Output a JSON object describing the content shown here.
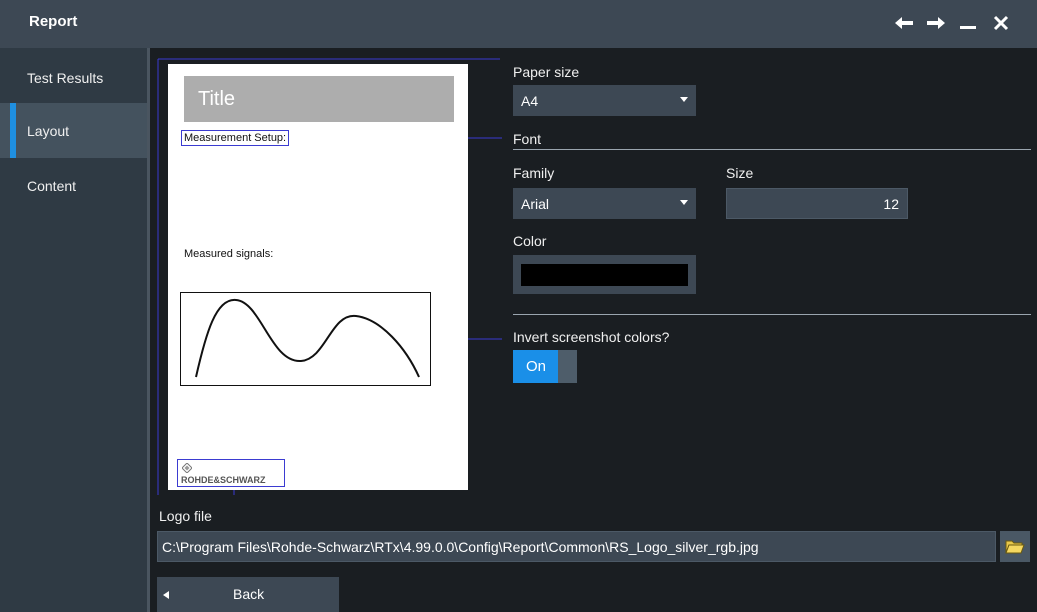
{
  "window": {
    "title": "Report",
    "buttons": [
      "back-arrow-icon",
      "forward-arrow-icon",
      "minimize-icon",
      "close-icon"
    ]
  },
  "sidebar": {
    "items": [
      {
        "label": "Test Results"
      },
      {
        "label": "Layout"
      },
      {
        "label": "Content"
      }
    ]
  },
  "preview": {
    "title": "Title",
    "measurement_setup": "Measurement Setup:",
    "measured_signals": "Measured signals:",
    "logo_text": "ROHDE&SCHWARZ"
  },
  "settings": {
    "paper_size_label": "Paper size",
    "paper_size_value": "A4",
    "font_section": "Font",
    "family_label": "Family",
    "family_value": "Arial",
    "size_label": "Size",
    "size_value": "12",
    "color_label": "Color",
    "color_value": "#000000",
    "invert_label": "Invert screenshot colors?",
    "invert_value": "On"
  },
  "logo_file": {
    "label": "Logo file",
    "path": "C:\\Program Files\\Rohde-Schwarz\\RTx\\4.99.0.0\\Config\\Report\\Common\\RS_Logo_silver_rgb.jpg"
  },
  "footer": {
    "back_label": "Back"
  },
  "colors": {
    "accent": "#1a8fe8",
    "titlebar": "#3d4854",
    "sidebar": "#2f3a44",
    "background": "#1a1e22"
  }
}
